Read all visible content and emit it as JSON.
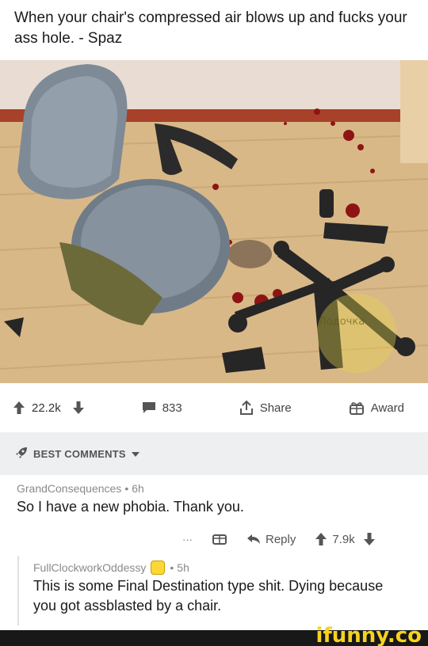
{
  "post": {
    "title": "When your chair's compressed air blows up and fucks your ass hole. - Spaz"
  },
  "image": {
    "description_icon": "photo-broken-office-chair",
    "watermark": "Лодочка"
  },
  "actions": {
    "upvotes": "22.2k",
    "comments": "833",
    "share": "Share",
    "award": "Award"
  },
  "best_comments": {
    "label": "BEST COMMENTS"
  },
  "comments": [
    {
      "author": "GrandConsequences",
      "separator": "•",
      "age": "6h",
      "text": "So I have a new phobia. Thank you.",
      "more": "···",
      "reply": "Reply",
      "score": "7.9k"
    },
    {
      "author": "FullClockworkOddessy",
      "separator": "•",
      "age": "5h",
      "text": "This is some Final Destination type shit. Dying because you got assblasted by a chair."
    }
  ],
  "branding": {
    "logo": "ifunny.co"
  },
  "colors": {
    "accent": "#0079d3",
    "logo": "#f7d21e",
    "section_bg": "#edeff1"
  }
}
